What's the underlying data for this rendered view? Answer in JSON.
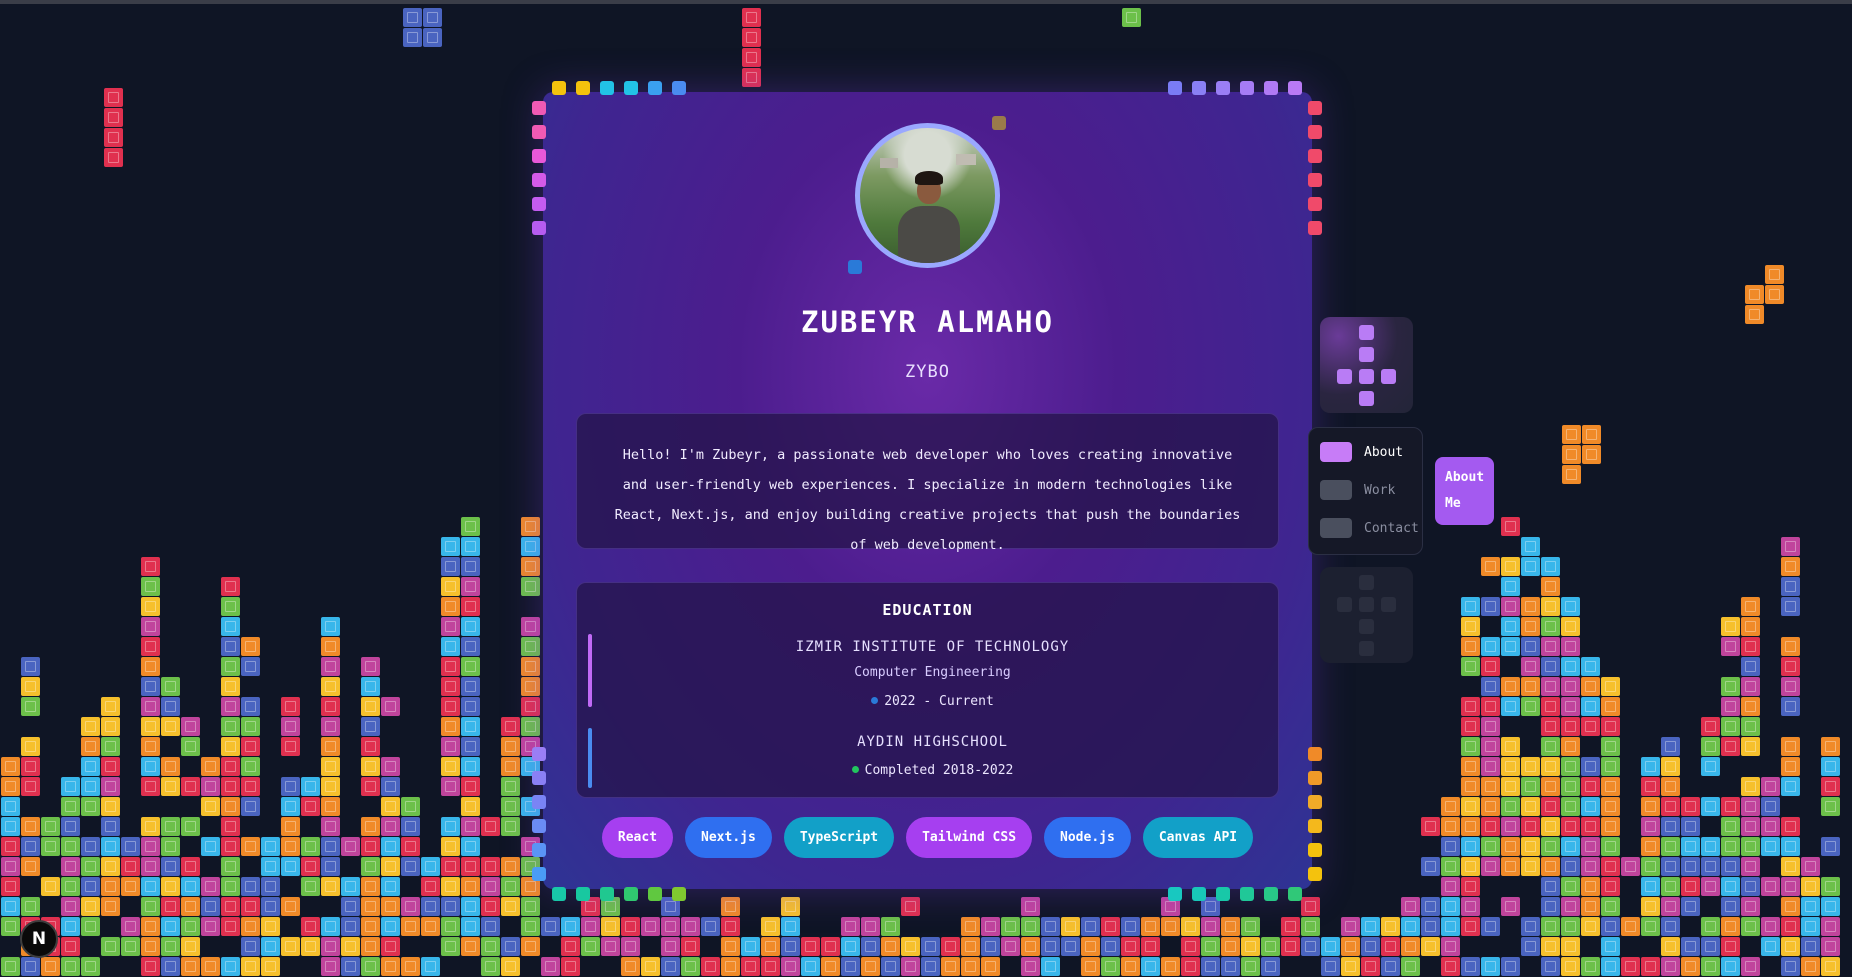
{
  "profile": {
    "name": "ZUBEYR ALMAHO",
    "nickname": "ZYBO",
    "bio": "Hello! I'm Zubeyr, a passionate web developer who loves creating innovative and user-friendly web experiences. I specialize in modern technologies like React, Next.js, and enjoy building creative projects that push the boundaries of web development."
  },
  "education": {
    "title": "EDUCATION",
    "entries": [
      {
        "school": "IZMIR INSTITUTE OF TECHNOLOGY",
        "degree": "Computer Engineering",
        "period": "2022 - Current",
        "bar_color": "#c06af5",
        "bullet_color": "#2a7ad8"
      },
      {
        "school": "AYDIN HIGHSCHOOL",
        "period": "Completed 2018-2022",
        "bar_color": "#4a8cf0",
        "bullet_color": "#22c55e"
      }
    ]
  },
  "skills": [
    {
      "label": "React",
      "color": "#a63ff0"
    },
    {
      "label": "Next.js",
      "color": "#2f6ff0"
    },
    {
      "label": "TypeScript",
      "color": "#12a0c8"
    },
    {
      "label": "Tailwind CSS",
      "color": "#a63ff0"
    },
    {
      "label": "Node.js",
      "color": "#2f6ff0"
    },
    {
      "label": "Canvas API",
      "color": "#12a0c8"
    }
  ],
  "nav": {
    "items": [
      {
        "label": "About",
        "active": true
      },
      {
        "label": "Work",
        "active": false
      },
      {
        "label": "Contact",
        "active": false
      }
    ],
    "callout": "About Me"
  },
  "badge": "N",
  "colors": {
    "background": "#0f1525",
    "tetris": [
      "#e0304f",
      "#f08a28",
      "#f6c02c",
      "#6cc04a",
      "#38b6ea",
      "#4a64c0",
      "#c0449c"
    ]
  }
}
